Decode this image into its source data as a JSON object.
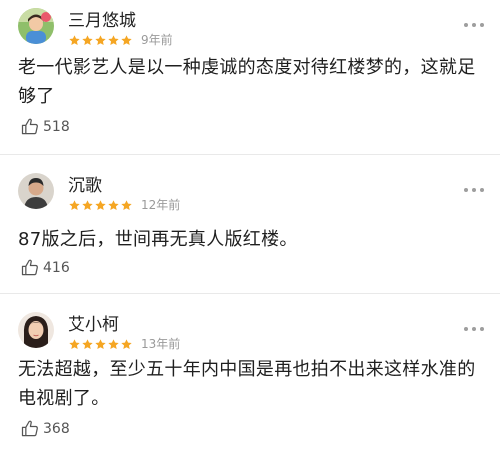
{
  "colors": {
    "star": "#f5a623",
    "meta": "#9a9a9a",
    "divider": "#e9e9e9"
  },
  "comments": [
    {
      "user": "三月悠城",
      "rating": 5,
      "time": "9年前",
      "text": "老一代影艺人是以一种虔诚的态度对待红楼梦的，这就足够了",
      "likes": "518",
      "avatar_icon": "avatar-photo-child-icon"
    },
    {
      "user": "沉歌",
      "rating": 5,
      "time": "12年前",
      "text": "87版之后，世间再无真人版红楼。",
      "likes": "416",
      "avatar_icon": "avatar-photo-man-icon"
    },
    {
      "user": "艾小柯",
      "rating": 5,
      "time": "13年前",
      "text": "无法超越，至少五十年内中国是再也拍不出来这样水准的电视剧了。",
      "likes": "368",
      "avatar_icon": "avatar-photo-woman-icon"
    }
  ]
}
